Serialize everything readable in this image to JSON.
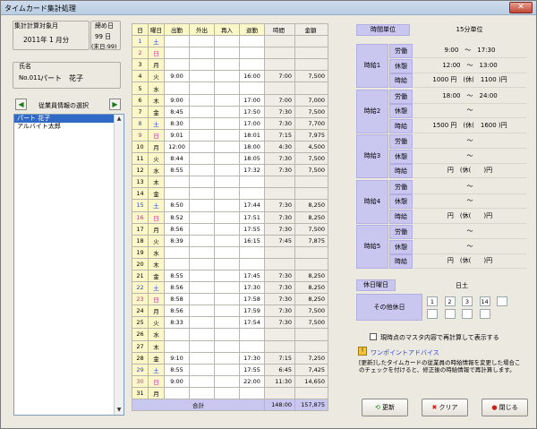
{
  "window": {
    "title": "タイムカード集計処理",
    "close": "✕"
  },
  "period": {
    "label": "集計計算対象月",
    "value": "2011年 1 月分",
    "cutoff_label": "締め日",
    "cutoff_value": "99 日",
    "cutoff_note": "(末日:99)"
  },
  "employee": {
    "label": "氏名",
    "id": "No.011",
    "name": "パート　花子"
  },
  "select_label": "従業員情報の選択",
  "employees": [
    "パート 花子",
    "アルバイト太郎"
  ],
  "table": {
    "headers": [
      "日",
      "曜日",
      "出勤",
      "外出",
      "再入",
      "退勤",
      "時間",
      "金額"
    ],
    "rows": [
      [
        "1",
        "土",
        "",
        "",
        "",
        "",
        "",
        ""
      ],
      [
        "2",
        "日",
        "",
        "",
        "",
        "",
        "",
        ""
      ],
      [
        "3",
        "月",
        "",
        "",
        "",
        "",
        "",
        ""
      ],
      [
        "4",
        "火",
        "9:00",
        "",
        "",
        "16:00",
        "7:00",
        "7,500"
      ],
      [
        "5",
        "水",
        "",
        "",
        "",
        "",
        "",
        ""
      ],
      [
        "6",
        "木",
        "9:00",
        "",
        "",
        "17:00",
        "7:00",
        "7,000"
      ],
      [
        "7",
        "金",
        "8:45",
        "",
        "",
        "17:50",
        "7:30",
        "7,500"
      ],
      [
        "8",
        "土",
        "8:30",
        "",
        "",
        "17:00",
        "7:30",
        "7,700"
      ],
      [
        "9",
        "日",
        "9:01",
        "",
        "",
        "18:01",
        "7:15",
        "7,975"
      ],
      [
        "10",
        "月",
        "12:00",
        "",
        "",
        "18:00",
        "4:30",
        "4,500"
      ],
      [
        "11",
        "火",
        "8:44",
        "",
        "",
        "18:05",
        "7:30",
        "7,500"
      ],
      [
        "12",
        "水",
        "8:55",
        "",
        "",
        "17:32",
        "7:30",
        "7,500"
      ],
      [
        "13",
        "木",
        "",
        "",
        "",
        "",
        "",
        ""
      ],
      [
        "14",
        "金",
        "",
        "",
        "",
        "",
        "",
        ""
      ],
      [
        "15",
        "土",
        "8:50",
        "",
        "",
        "17:44",
        "7:30",
        "8,250"
      ],
      [
        "16",
        "日",
        "8:52",
        "",
        "",
        "17:51",
        "7:30",
        "8,250"
      ],
      [
        "17",
        "月",
        "8:56",
        "",
        "",
        "17:55",
        "7:30",
        "7,500"
      ],
      [
        "18",
        "火",
        "8:39",
        "",
        "",
        "16:15",
        "7:45",
        "7,875"
      ],
      [
        "19",
        "水",
        "",
        "",
        "",
        "",
        "",
        ""
      ],
      [
        "20",
        "木",
        "",
        "",
        "",
        "",
        "",
        ""
      ],
      [
        "21",
        "金",
        "8:55",
        "",
        "",
        "17:45",
        "7:30",
        "8,250"
      ],
      [
        "22",
        "土",
        "8:56",
        "",
        "",
        "17:30",
        "7:30",
        "8,250"
      ],
      [
        "23",
        "日",
        "8:58",
        "",
        "",
        "17:58",
        "7:30",
        "8,250"
      ],
      [
        "24",
        "月",
        "8:56",
        "",
        "",
        "17:59",
        "7:30",
        "7,500"
      ],
      [
        "25",
        "火",
        "8:33",
        "",
        "",
        "17:54",
        "7:30",
        "7,500"
      ],
      [
        "26",
        "水",
        "",
        "",
        "",
        "",
        "",
        ""
      ],
      [
        "27",
        "木",
        "",
        "",
        "",
        "",
        "",
        ""
      ],
      [
        "28",
        "金",
        "9:10",
        "",
        "",
        "17:30",
        "7:15",
        "7,250"
      ],
      [
        "29",
        "土",
        "8:55",
        "",
        "",
        "17:55",
        "6:45",
        "7,425"
      ],
      [
        "30",
        "日",
        "9:00",
        "",
        "",
        "22:00",
        "11:30",
        "14,650"
      ],
      [
        "31",
        "月",
        "",
        "",
        "",
        "",
        "",
        ""
      ]
    ],
    "total_label": "合計",
    "total_hours": "148:00",
    "total_amount": "157,875"
  },
  "rules": {
    "unit_label": "時間単位",
    "unit_value": "15分単位",
    "blocks": [
      {
        "name": "時給1",
        "labor": "9:00　～　17:30",
        "rest": "12:00　～　13:00",
        "wage": "1000 円　(休(　1100 )円"
      },
      {
        "name": "時給2",
        "labor": "18:00　～　24:00",
        "rest": "～",
        "wage": "1500 円　(休(　1600 )円"
      },
      {
        "name": "時給3",
        "labor": "～",
        "rest": "～",
        "wage": "円　(休(　　)円"
      },
      {
        "name": "時給4",
        "labor": "～",
        "rest": "～",
        "wage": "円　(休(　　)円"
      },
      {
        "name": "時給5",
        "labor": "～",
        "rest": "～",
        "wage": "円　(休(　　)円"
      }
    ],
    "labor_label": "労働",
    "rest_label": "休憩",
    "wage_label": "時給",
    "holiday_label": "休日曜日",
    "holiday_value": "日土",
    "other_label": "その他休日",
    "other_values": [
      "1",
      "2",
      "3",
      "14",
      "",
      "",
      "",
      "",
      ""
    ],
    "checkbox": "現時点のマスタ内容で再計算して表示する",
    "advice_title": "ワンポイントアドバイス",
    "advice_text": "[更新]したタイムカードの従業員の時給情報を変更した場合このチェックを付けると、修正後の時給情報で再計算します。"
  },
  "buttons": {
    "update": "更新",
    "clear": "クリア",
    "close": "閉じる"
  },
  "colors": {
    "sat": "#2a4ae0",
    "sun": "#d12aa2"
  }
}
